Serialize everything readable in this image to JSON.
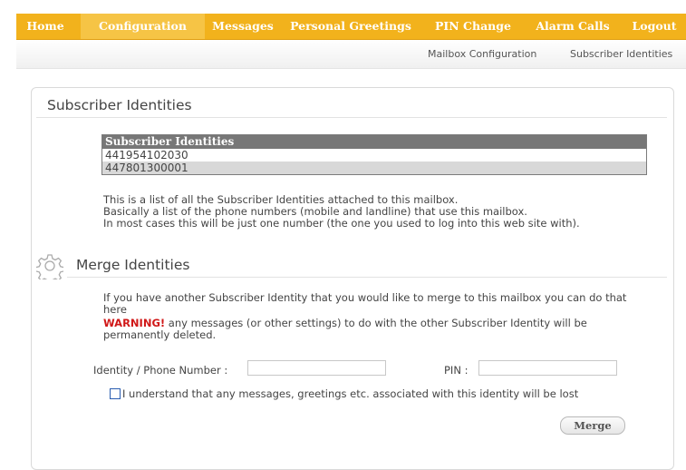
{
  "nav": {
    "items": [
      {
        "label": "Home"
      },
      {
        "label": "Configuration"
      },
      {
        "label": "Messages"
      },
      {
        "label": "Personal Greetings"
      },
      {
        "label": "PIN Change"
      },
      {
        "label": "Alarm Calls"
      },
      {
        "label": "Logout"
      }
    ],
    "active": "Configuration"
  },
  "subnav": {
    "items": [
      {
        "label": "Mailbox Configuration"
      },
      {
        "label": "Subscriber Identities"
      }
    ]
  },
  "section1": {
    "title": "Subscriber Identities",
    "table": {
      "header": "Subscriber Identities",
      "rows": [
        "441954102030",
        "447801300001"
      ]
    },
    "desc": [
      "This is a list of all the Subscriber Identities attached to this mailbox.",
      "Basically a list of the phone numbers (mobile and landline) that use this mailbox.",
      "In most cases this will be just one number (the one you used to log into this web site with)."
    ]
  },
  "section2": {
    "title": "Merge Identities",
    "icon": "gear-icon",
    "intro": "If you have another Subscriber Identity that you would like to merge to this mailbox you can do that here",
    "warning_label": "WARNING!",
    "warning_text": " any messages (or other settings) to do with the other Subscriber Identity will be permanently deleted.",
    "identity_label": "Identity / Phone Number :",
    "identity_value": "",
    "pin_label": "PIN :",
    "pin_value": "",
    "checkbox_label": "I understand that any messages, greetings etc. associated with this identity will be lost",
    "checkbox_checked": false,
    "merge_label": "Merge"
  },
  "colors": {
    "nav_bg": "#f2b21c",
    "nav_active": "#f6c445",
    "warning": "#d01818",
    "table_header": "#777777"
  }
}
